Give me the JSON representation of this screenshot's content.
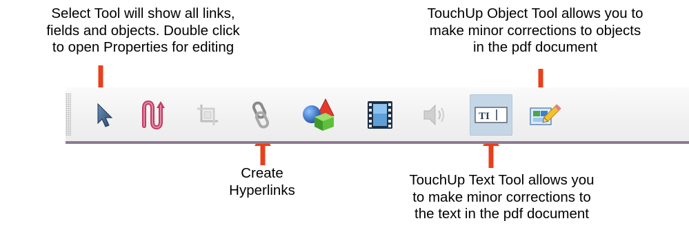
{
  "callouts": {
    "select_tool": {
      "lines": [
        "Select Tool will show all links,",
        "fields and objects. Double click",
        "to open Properties for editing"
      ]
    },
    "touchup_object_tool": {
      "lines": [
        "TouchUp Object Tool allows you to",
        "make minor corrections to objects",
        "in the pdf document"
      ]
    },
    "create_hyperlinks": {
      "lines": [
        "Create",
        "Hyperlinks"
      ]
    },
    "touchup_text_tool": {
      "lines": [
        "TouchUp Text Tool allows you",
        "to make minor corrections to",
        "the text in the pdf document"
      ]
    }
  },
  "colors": {
    "arrow": "#e8401c",
    "toolbar_border": "#8d7a93",
    "active_tool_bg": "#c5d6e6"
  },
  "toolbar": {
    "tools": [
      {
        "name": "select-tool",
        "icon": "cursor-arrow-icon",
        "active": false
      },
      {
        "name": "article-tool",
        "icon": "article-thread-icon",
        "active": false
      },
      {
        "name": "crop-tool",
        "icon": "crop-icon",
        "active": false
      },
      {
        "name": "link-tool",
        "icon": "chain-link-icon",
        "active": false
      },
      {
        "name": "3d-tool",
        "icon": "3d-shapes-icon",
        "active": false
      },
      {
        "name": "video-tool",
        "icon": "film-strip-icon",
        "active": false
      },
      {
        "name": "sound-tool",
        "icon": "speaker-icon",
        "active": false
      },
      {
        "name": "touchup-text-tool",
        "icon": "text-cursor-box-icon",
        "active": true
      },
      {
        "name": "touchup-object-tool",
        "icon": "pencil-edit-icon",
        "active": false
      }
    ]
  }
}
